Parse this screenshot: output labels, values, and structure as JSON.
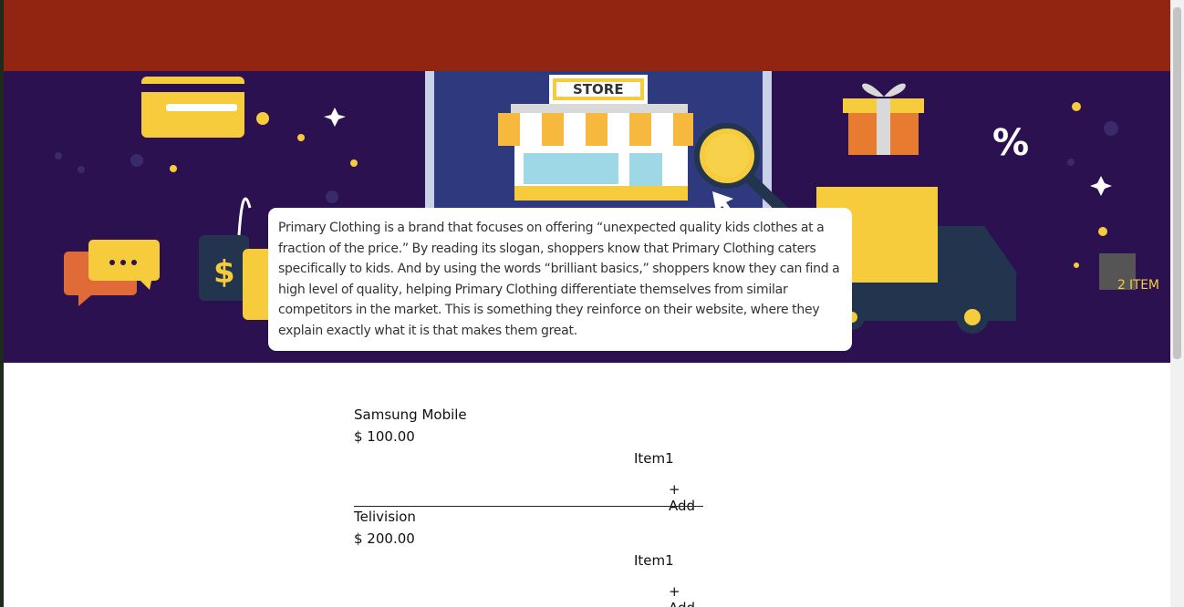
{
  "banner": {
    "store_sign": "STORE",
    "percent_sign": "%",
    "description": "Primary Clothing is a brand that focuses on offering “unexpected quality kids clothes at a fraction of the price.” By reading its slogan, shoppers know that Primary Clothing caters specifically to kids. And by using the words “brilliant basics,” shoppers know they can find a high level of quality, helping Primary Clothing differentiate themselves from similar competitors in the market. This is something they reinforce on their website, where they explain exactly what it is that makes them great."
  },
  "cart": {
    "count_label": "2 ITEM"
  },
  "products": [
    {
      "name": "Samsung Mobile",
      "price": "$ 100.00",
      "item_label": "Item1",
      "add_label": "+ Add"
    },
    {
      "name": "Telivision",
      "price": "$ 200.00",
      "item_label": "Item1",
      "add_label": "+ Add"
    }
  ],
  "colors": {
    "header": "#922412",
    "banner_bg": "#2b1150",
    "accent_yellow": "#f6cc3d",
    "cart_badge": "#555555"
  }
}
